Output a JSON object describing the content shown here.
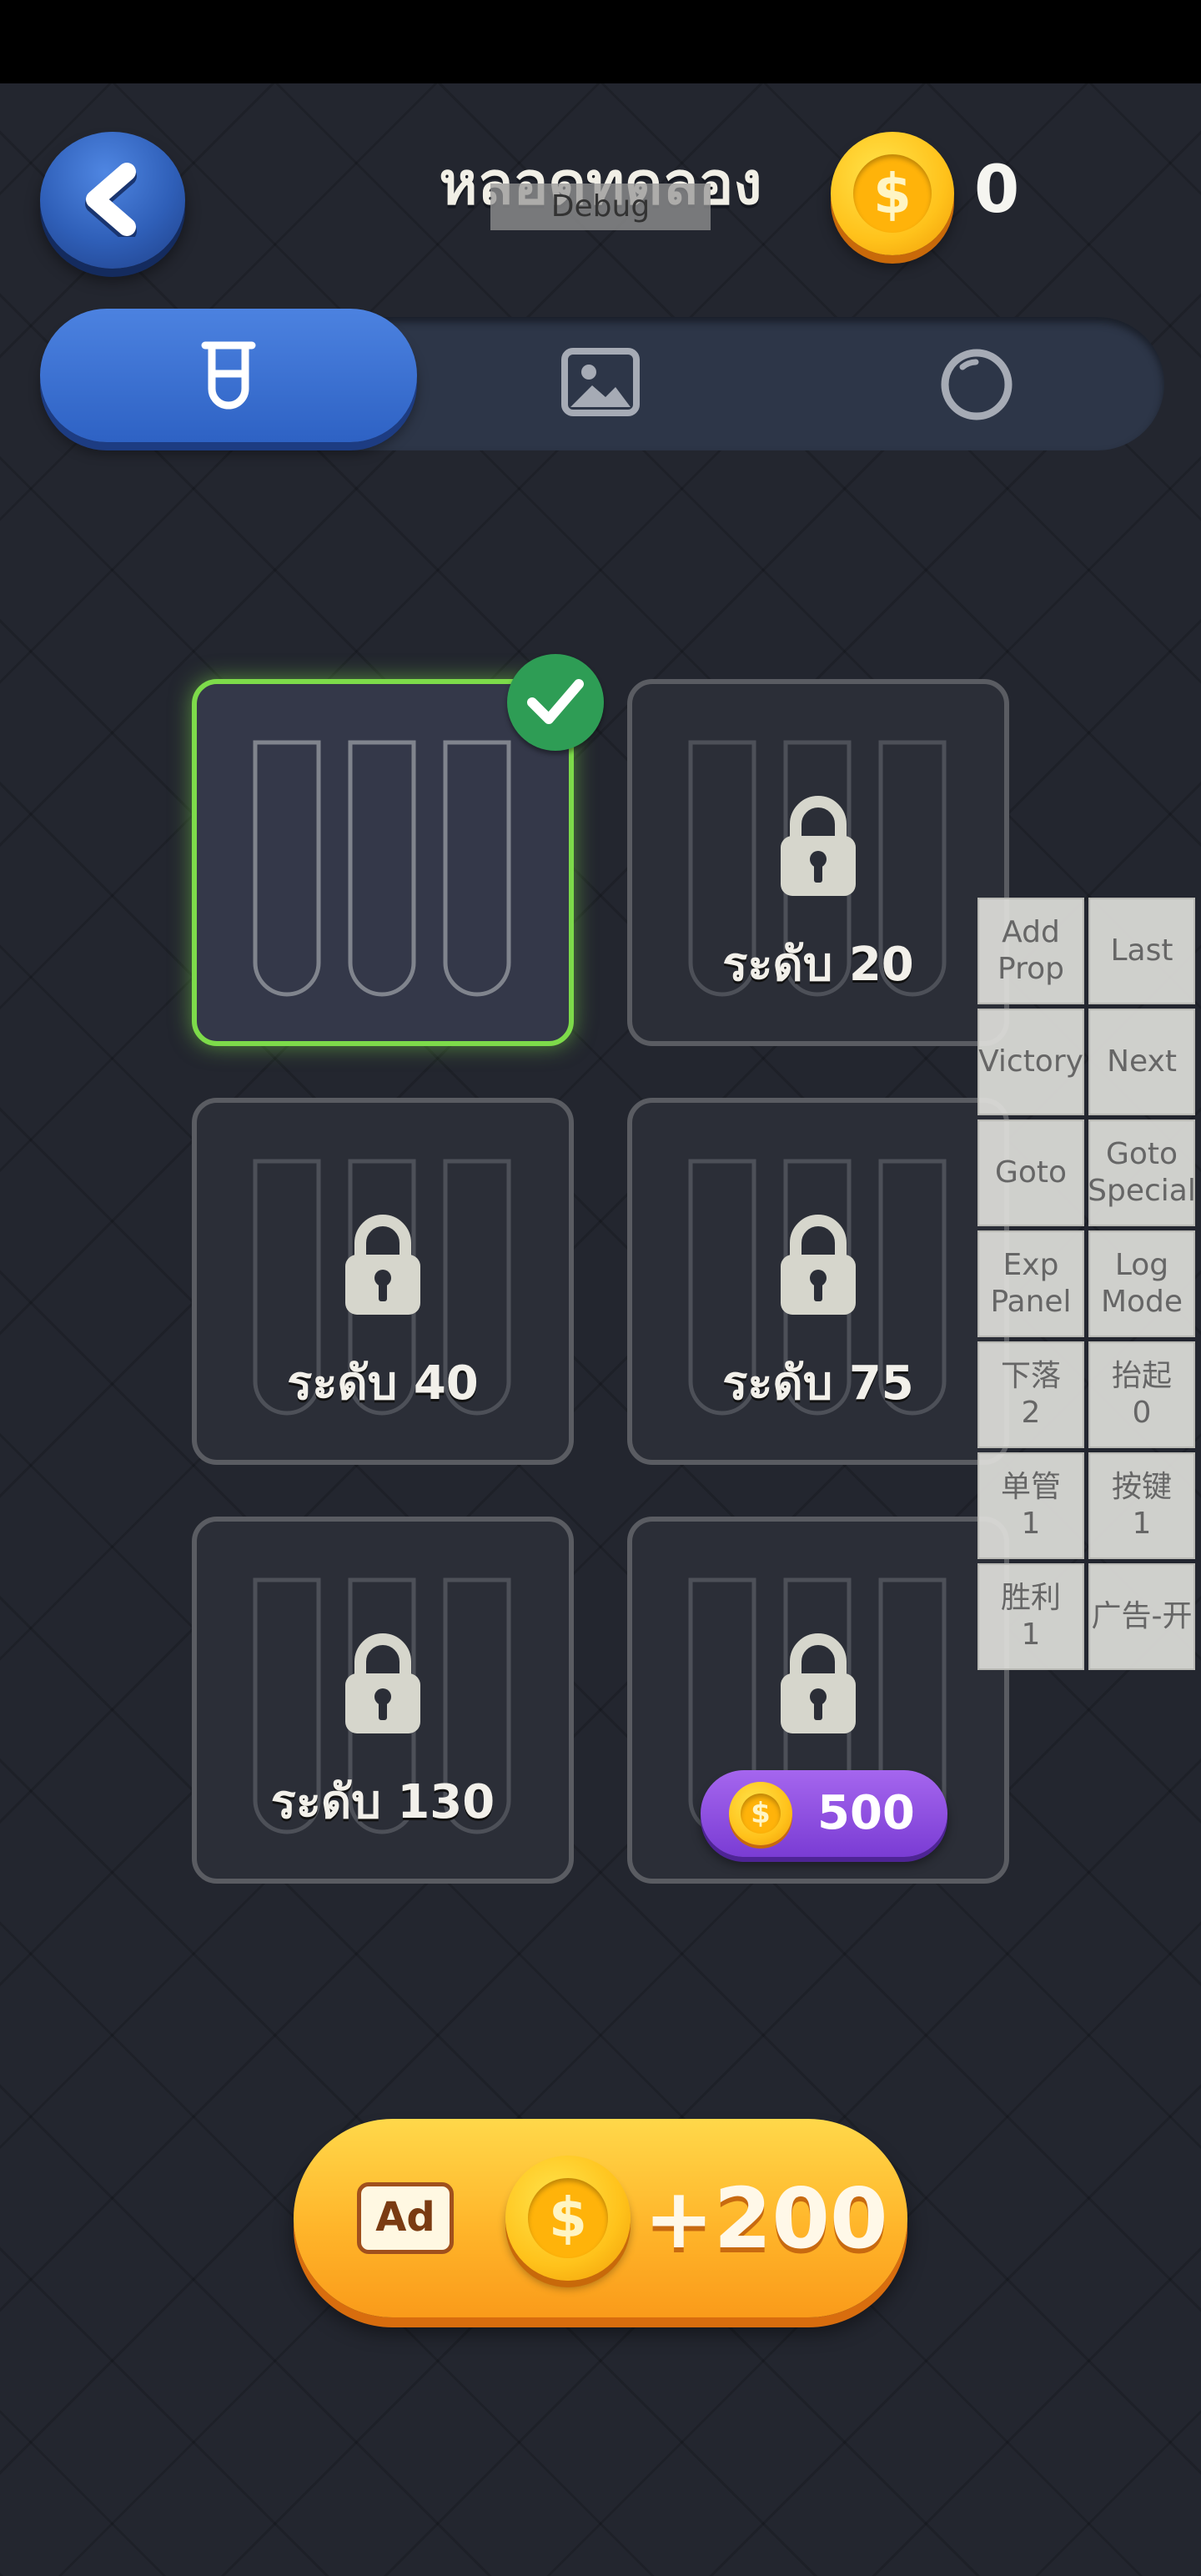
{
  "header": {
    "title": "หลอดทดลอง",
    "debug_label": "Debug",
    "coin_icon": "coin-icon",
    "coin_symbol": "$",
    "coins": "0"
  },
  "tabs": [
    {
      "icon": "test-tube-icon",
      "selected": true
    },
    {
      "icon": "image-icon",
      "selected": false
    },
    {
      "icon": "circle-icon",
      "selected": false
    }
  ],
  "levels": [
    {
      "label": "",
      "locked": false,
      "selected": true
    },
    {
      "label": "ระดับ 20",
      "locked": true
    },
    {
      "label": "ระดับ 40",
      "locked": true
    },
    {
      "label": "ระดับ 75",
      "locked": true
    },
    {
      "label": "ระดับ 130",
      "locked": true
    },
    {
      "label": "",
      "locked": true,
      "price": "500",
      "price_symbol": "$"
    }
  ],
  "debug_panel": [
    [
      "Add",
      "Prop"
    ],
    [
      "Last"
    ],
    [
      "Victory"
    ],
    [
      "Next"
    ],
    [
      "Goto"
    ],
    [
      "Goto",
      "Special"
    ],
    [
      "Exp",
      "Panel"
    ],
    [
      "Log",
      "Mode"
    ],
    [
      "下落",
      "2"
    ],
    [
      "抬起",
      "0"
    ],
    [
      "单管",
      "1"
    ],
    [
      "按键",
      "1"
    ],
    [
      "胜利",
      "1"
    ],
    [
      "广告-开"
    ]
  ],
  "reward": {
    "ad_label": "Ad",
    "coin_symbol": "$",
    "amount": "+200"
  },
  "colors": {
    "background": "#23262f",
    "accent_blue": "#2e62c4",
    "selected_border": "#7ddb4a",
    "coin_gold": "#ffc21b",
    "price_purple": "#7a3cd4",
    "reward_orange": "#ffb52a"
  }
}
